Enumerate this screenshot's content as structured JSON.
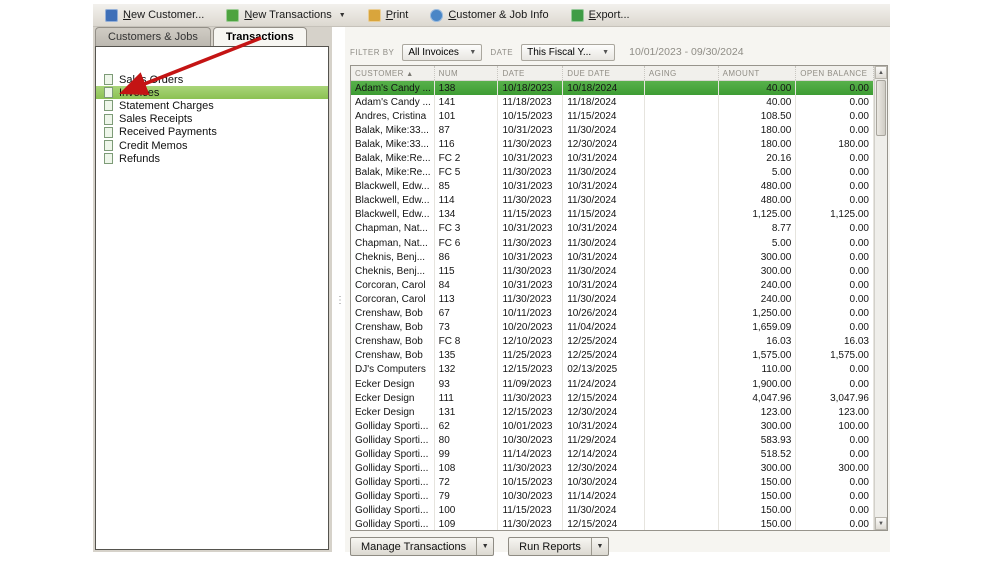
{
  "icons": {
    "caret_down": "▼",
    "scroll_up": "▲",
    "scroll_down": "▼",
    "sort_asc": "▲",
    "grip": "⋮"
  },
  "toolbar": {
    "buttons": [
      {
        "name": "new-customer",
        "label": "New Customer...",
        "icon": "new-customer-icon",
        "dropdown": false
      },
      {
        "name": "new-transactions",
        "label": "New Transactions",
        "icon": "new-transactions-icon",
        "dropdown": true
      },
      {
        "name": "print",
        "label": "Print",
        "icon": "print-icon",
        "dropdown": false
      },
      {
        "name": "customer-job-info",
        "label": "Customer & Job Info",
        "icon": "customer-info-icon",
        "dropdown": false
      },
      {
        "name": "export",
        "label": "Export...",
        "icon": "export-icon",
        "dropdown": false
      }
    ]
  },
  "left_panel": {
    "tabs": [
      {
        "label": "Customers & Jobs",
        "active": false
      },
      {
        "label": "Transactions",
        "active": true
      }
    ],
    "items": [
      {
        "label": "Sales Orders",
        "selected": false
      },
      {
        "label": "Invoices",
        "selected": true
      },
      {
        "label": "Statement Charges",
        "selected": false
      },
      {
        "label": "Sales Receipts",
        "selected": false
      },
      {
        "label": "Received Payments",
        "selected": false
      },
      {
        "label": "Credit Memos",
        "selected": false
      },
      {
        "label": "Refunds",
        "selected": false
      }
    ]
  },
  "filter_bar": {
    "filter_by_label": "FILTER BY",
    "filter_by_value": "All Invoices",
    "date_label": "DATE",
    "date_value": "This Fiscal Y...",
    "date_range": "10/01/2023 - 09/30/2024"
  },
  "table": {
    "columns": [
      {
        "label": "CUSTOMER",
        "key": "customer",
        "sort": "asc"
      },
      {
        "label": "NUM",
        "key": "num"
      },
      {
        "label": "DATE",
        "key": "date"
      },
      {
        "label": "DUE DATE",
        "key": "due_date"
      },
      {
        "label": "AGING",
        "key": "aging"
      },
      {
        "label": "AMOUNT",
        "key": "amount"
      },
      {
        "label": "OPEN BALANCE",
        "key": "open_balance"
      }
    ],
    "rows": [
      {
        "customer": "Adam's Candy ...",
        "num": "138",
        "date": "10/18/2023",
        "due_date": "10/18/2024",
        "aging": "",
        "amount": "40.00",
        "open_balance": "0.00",
        "selected": true
      },
      {
        "customer": "Adam's Candy ...",
        "num": "141",
        "date": "11/18/2023",
        "due_date": "11/18/2024",
        "aging": "",
        "amount": "40.00",
        "open_balance": "0.00",
        "selected": false
      },
      {
        "customer": "Andres, Cristina",
        "num": "101",
        "date": "10/15/2023",
        "due_date": "11/15/2024",
        "aging": "",
        "amount": "108.50",
        "open_balance": "0.00",
        "selected": false
      },
      {
        "customer": "Balak, Mike:33...",
        "num": "87",
        "date": "10/31/2023",
        "due_date": "11/30/2024",
        "aging": "",
        "amount": "180.00",
        "open_balance": "0.00",
        "selected": false
      },
      {
        "customer": "Balak, Mike:33...",
        "num": "116",
        "date": "11/30/2023",
        "due_date": "12/30/2024",
        "aging": "",
        "amount": "180.00",
        "open_balance": "180.00",
        "selected": false
      },
      {
        "customer": "Balak, Mike:Re...",
        "num": "FC 2",
        "date": "10/31/2023",
        "due_date": "10/31/2024",
        "aging": "",
        "amount": "20.16",
        "open_balance": "0.00",
        "selected": false
      },
      {
        "customer": "Balak, Mike:Re...",
        "num": "FC 5",
        "date": "11/30/2023",
        "due_date": "11/30/2024",
        "aging": "",
        "amount": "5.00",
        "open_balance": "0.00",
        "selected": false
      },
      {
        "customer": "Blackwell, Edw...",
        "num": "85",
        "date": "10/31/2023",
        "due_date": "10/31/2024",
        "aging": "",
        "amount": "480.00",
        "open_balance": "0.00",
        "selected": false
      },
      {
        "customer": "Blackwell, Edw...",
        "num": "114",
        "date": "11/30/2023",
        "due_date": "11/30/2024",
        "aging": "",
        "amount": "480.00",
        "open_balance": "0.00",
        "selected": false
      },
      {
        "customer": "Blackwell, Edw...",
        "num": "134",
        "date": "11/15/2023",
        "due_date": "11/15/2024",
        "aging": "",
        "amount": "1,125.00",
        "open_balance": "1,125.00",
        "selected": false
      },
      {
        "customer": "Chapman, Nat...",
        "num": "FC 3",
        "date": "10/31/2023",
        "due_date": "10/31/2024",
        "aging": "",
        "amount": "8.77",
        "open_balance": "0.00",
        "selected": false
      },
      {
        "customer": "Chapman, Nat...",
        "num": "FC 6",
        "date": "11/30/2023",
        "due_date": "11/30/2024",
        "aging": "",
        "amount": "5.00",
        "open_balance": "0.00",
        "selected": false
      },
      {
        "customer": "Cheknis, Benj...",
        "num": "86",
        "date": "10/31/2023",
        "due_date": "10/31/2024",
        "aging": "",
        "amount": "300.00",
        "open_balance": "0.00",
        "selected": false
      },
      {
        "customer": "Cheknis, Benj...",
        "num": "115",
        "date": "11/30/2023",
        "due_date": "11/30/2024",
        "aging": "",
        "amount": "300.00",
        "open_balance": "0.00",
        "selected": false
      },
      {
        "customer": "Corcoran, Carol",
        "num": "84",
        "date": "10/31/2023",
        "due_date": "10/31/2024",
        "aging": "",
        "amount": "240.00",
        "open_balance": "0.00",
        "selected": false
      },
      {
        "customer": "Corcoran, Carol",
        "num": "113",
        "date": "11/30/2023",
        "due_date": "11/30/2024",
        "aging": "",
        "amount": "240.00",
        "open_balance": "0.00",
        "selected": false
      },
      {
        "customer": "Crenshaw, Bob",
        "num": "67",
        "date": "10/11/2023",
        "due_date": "10/26/2024",
        "aging": "",
        "amount": "1,250.00",
        "open_balance": "0.00",
        "selected": false
      },
      {
        "customer": "Crenshaw, Bob",
        "num": "73",
        "date": "10/20/2023",
        "due_date": "11/04/2024",
        "aging": "",
        "amount": "1,659.09",
        "open_balance": "0.00",
        "selected": false
      },
      {
        "customer": "Crenshaw, Bob",
        "num": "FC 8",
        "date": "12/10/2023",
        "due_date": "12/25/2024",
        "aging": "",
        "amount": "16.03",
        "open_balance": "16.03",
        "selected": false
      },
      {
        "customer": "Crenshaw, Bob",
        "num": "135",
        "date": "11/25/2023",
        "due_date": "12/25/2024",
        "aging": "",
        "amount": "1,575.00",
        "open_balance": "1,575.00",
        "selected": false
      },
      {
        "customer": "DJ's Computers",
        "num": "132",
        "date": "12/15/2023",
        "due_date": "02/13/2025",
        "aging": "",
        "amount": "110.00",
        "open_balance": "0.00",
        "selected": false
      },
      {
        "customer": "Ecker Design",
        "num": "93",
        "date": "11/09/2023",
        "due_date": "11/24/2024",
        "aging": "",
        "amount": "1,900.00",
        "open_balance": "0.00",
        "selected": false
      },
      {
        "customer": "Ecker Design",
        "num": "111",
        "date": "11/30/2023",
        "due_date": "12/15/2024",
        "aging": "",
        "amount": "4,047.96",
        "open_balance": "3,047.96",
        "selected": false
      },
      {
        "customer": "Ecker Design",
        "num": "131",
        "date": "12/15/2023",
        "due_date": "12/30/2024",
        "aging": "",
        "amount": "123.00",
        "open_balance": "123.00",
        "selected": false
      },
      {
        "customer": "Golliday Sporti...",
        "num": "62",
        "date": "10/01/2023",
        "due_date": "10/31/2024",
        "aging": "",
        "amount": "300.00",
        "open_balance": "100.00",
        "selected": false
      },
      {
        "customer": "Golliday Sporti...",
        "num": "80",
        "date": "10/30/2023",
        "due_date": "11/29/2024",
        "aging": "",
        "amount": "583.93",
        "open_balance": "0.00",
        "selected": false
      },
      {
        "customer": "Golliday Sporti...",
        "num": "99",
        "date": "11/14/2023",
        "due_date": "12/14/2024",
        "aging": "",
        "amount": "518.52",
        "open_balance": "0.00",
        "selected": false
      },
      {
        "customer": "Golliday Sporti...",
        "num": "108",
        "date": "11/30/2023",
        "due_date": "12/30/2024",
        "aging": "",
        "amount": "300.00",
        "open_balance": "300.00",
        "selected": false
      },
      {
        "customer": "Golliday Sporti...",
        "num": "72",
        "date": "10/15/2023",
        "due_date": "10/30/2024",
        "aging": "",
        "amount": "150.00",
        "open_balance": "0.00",
        "selected": false
      },
      {
        "customer": "Golliday Sporti...",
        "num": "79",
        "date": "10/30/2023",
        "due_date": "11/14/2024",
        "aging": "",
        "amount": "150.00",
        "open_balance": "0.00",
        "selected": false
      },
      {
        "customer": "Golliday Sporti...",
        "num": "100",
        "date": "11/15/2023",
        "due_date": "11/30/2024",
        "aging": "",
        "amount": "150.00",
        "open_balance": "0.00",
        "selected": false
      },
      {
        "customer": "Golliday Sporti...",
        "num": "109",
        "date": "11/30/2023",
        "due_date": "12/15/2024",
        "aging": "",
        "amount": "150.00",
        "open_balance": "0.00",
        "selected": false
      }
    ]
  },
  "footer": {
    "buttons": [
      {
        "name": "manage-transactions",
        "label": "Manage Transactions"
      },
      {
        "name": "run-reports",
        "label": "Run Reports"
      }
    ]
  }
}
